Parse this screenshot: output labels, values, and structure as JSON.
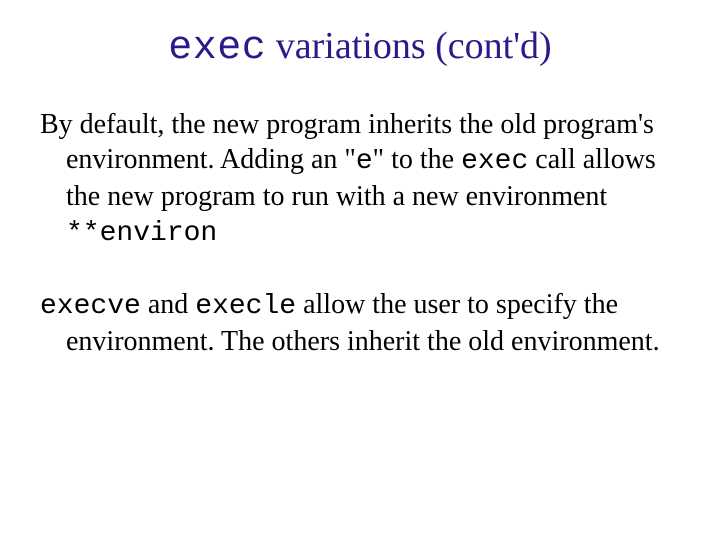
{
  "title": {
    "code": "exec",
    "rest": " variations (cont'd)"
  },
  "p1": {
    "t1": "By default, the new program inherits the old program's environment.  Adding an \"",
    "c1": "e",
    "t2": "\" to the ",
    "c2": "exec",
    "t3": " call allows the new program to run with a new environment ",
    "c3": "**environ"
  },
  "p2": {
    "c1": "execve",
    "t1": "  and ",
    "c2": "execle",
    "t2": " allow the user to specify the environment.  The others inherit the old environment."
  }
}
